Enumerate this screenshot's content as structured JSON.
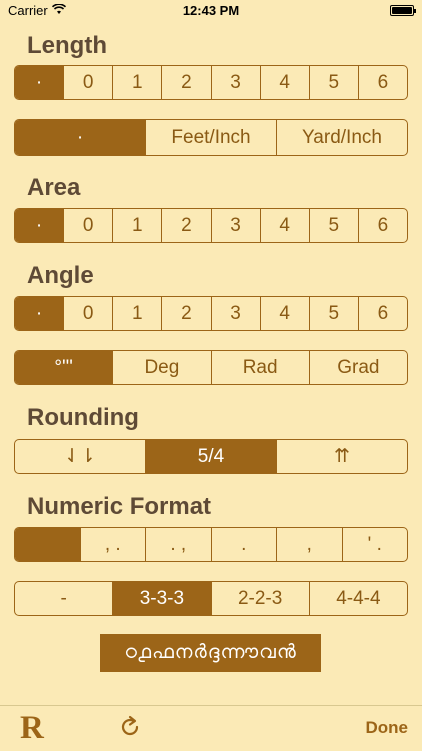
{
  "status_bar": {
    "carrier": "Carrier",
    "time": "12:43 PM"
  },
  "sections": {
    "length": {
      "title": "Length",
      "precision": [
        "·",
        "0",
        "1",
        "2",
        "3",
        "4",
        "5",
        "6"
      ],
      "units": [
        "·",
        "Feet/Inch",
        "Yard/Inch"
      ]
    },
    "area": {
      "title": "Area",
      "precision": [
        "·",
        "0",
        "1",
        "2",
        "3",
        "4",
        "5",
        "6"
      ]
    },
    "angle": {
      "title": "Angle",
      "precision": [
        "·",
        "0",
        "1",
        "2",
        "3",
        "4",
        "5",
        "6"
      ],
      "units": [
        "°'''",
        "Deg",
        "Rad",
        "Grad"
      ]
    },
    "rounding": {
      "title": "Rounding",
      "options": [
        "⇃⇂",
        "5/4",
        "⇈"
      ]
    },
    "numeric_format": {
      "title": "Numeric Format",
      "separators": [
        "",
        ", .",
        ". ,",
        ".",
        ",",
        "' ."
      ],
      "grouping": [
        "-",
        "3-3-3",
        "2-2-3",
        "4-4-4"
      ]
    }
  },
  "language_button": "ഠ൧ഫനർദ്ദന്നൗവൻ",
  "toolbar": {
    "logo": "R",
    "done": "Done",
    "refresh_icon": "refresh-icon"
  },
  "colors": {
    "background": "#fbeab6",
    "accent": "#9c6518",
    "heading": "#5e4a36"
  }
}
